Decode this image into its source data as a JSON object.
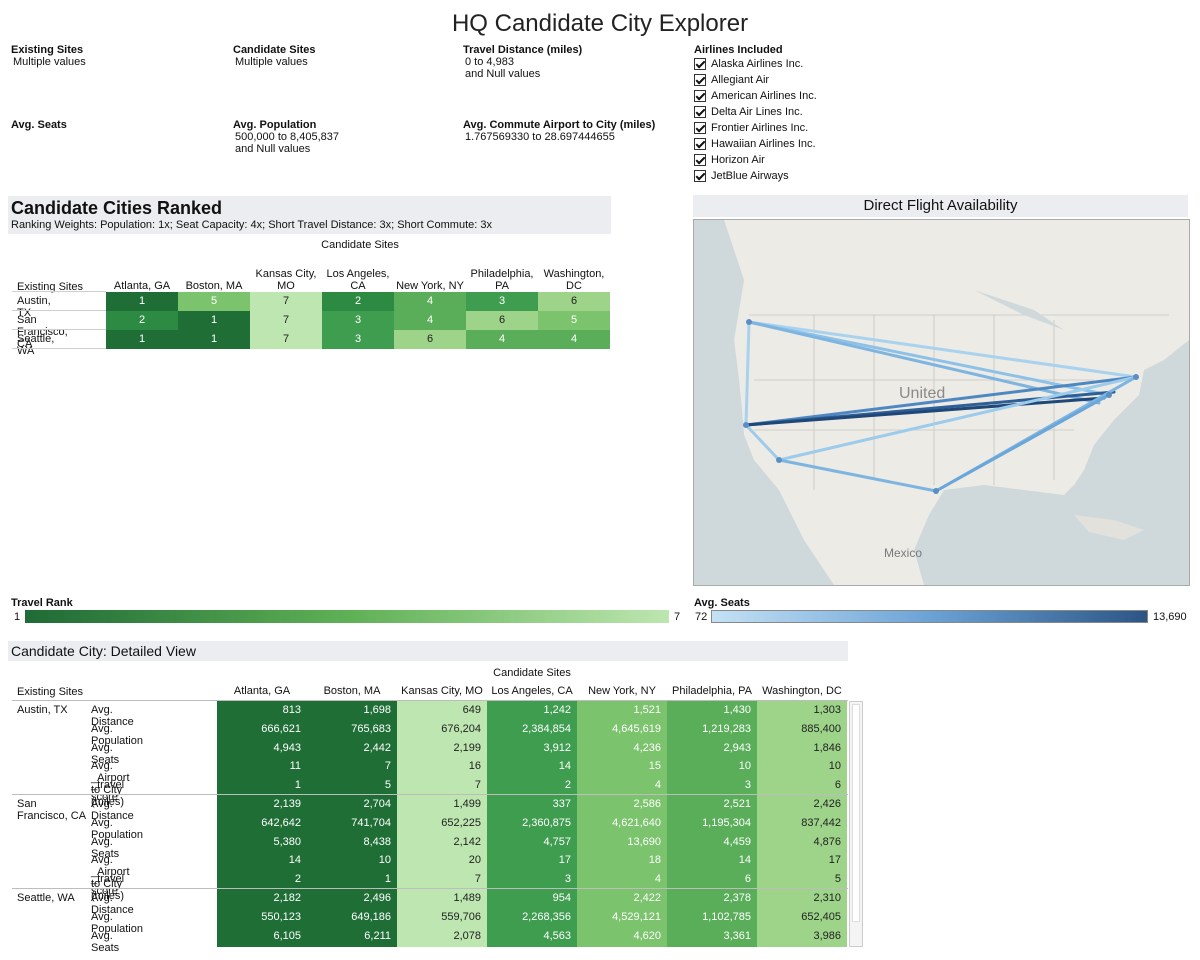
{
  "title": "HQ Candidate City Explorer",
  "filters": {
    "existing_sites": {
      "label": "Existing Sites",
      "value": "Multiple values"
    },
    "candidate_sites": {
      "label": "Candidate Sites",
      "value": "Multiple values"
    },
    "travel_distance": {
      "label": "Travel Distance (miles)",
      "value": "0 to 4,983\nand Null values"
    },
    "avg_seats": {
      "label": "Avg. Seats",
      "value": ""
    },
    "avg_population": {
      "label": "Avg. Population",
      "value": "500,000 to 8,405,837\nand Null values"
    },
    "avg_commute": {
      "label": "Avg. Commute Airport to City (miles)",
      "value": "1.767569330 to 28.697444655"
    }
  },
  "airlines": {
    "label": "Airlines Included",
    "items": [
      "Alaska Airlines Inc.",
      "Allegiant Air",
      "American Airlines Inc.",
      "Delta Air Lines Inc.",
      "Frontier Airlines Inc.",
      "Hawaiian Airlines Inc.",
      "Horizon Air",
      "JetBlue Airways"
    ]
  },
  "ranked": {
    "title": "Candidate Cities Ranked",
    "subtitle": "Ranking Weights: Population: 1x; Seat Capacity: 4x; Short Travel Distance: 3x; Short Commute: 3x",
    "col_group": "Candidate Sites",
    "row_header": "Existing Sites",
    "columns": [
      "Atlanta, GA",
      "Boston, MA",
      "Kansas City, MO",
      "Los Angeles, CA",
      "New York, NY",
      "Philadelphia, PA",
      "Washington, DC"
    ],
    "rows": [
      {
        "site": "Austin, TX",
        "ranks": [
          1,
          5,
          7,
          2,
          4,
          3,
          6
        ]
      },
      {
        "site": "San Francisco, CA",
        "ranks": [
          2,
          1,
          7,
          3,
          4,
          6,
          5
        ]
      },
      {
        "site": "Seattle, WA",
        "ranks": [
          1,
          1,
          7,
          3,
          6,
          4,
          4
        ]
      }
    ]
  },
  "map": {
    "title": "Direct Flight Availability",
    "country_label": "United",
    "mexico_label": "Mexico"
  },
  "legend_travel": {
    "label": "Travel Rank",
    "min": "1",
    "max": "7"
  },
  "legend_seats": {
    "label": "Avg. Seats",
    "min": "72",
    "max": "13,690"
  },
  "detail": {
    "title": "Candidate City: Detailed View",
    "col_group": "Candidate Sites",
    "row_header": "Existing Sites",
    "columns": [
      "Atlanta, GA",
      "Boston, MA",
      "Kansas City, MO",
      "Los Angeles, CA",
      "New York, NY",
      "Philadelphia, PA",
      "Washington, DC"
    ],
    "col_ranks_note": "column shading follows travel rank",
    "groups": [
      {
        "site": "Austin, TX",
        "rows": [
          {
            "measure": "Avg. Distance",
            "values": [
              "813",
              "1,698",
              "649",
              "1,242",
              "1,521",
              "1,430",
              "1,303"
            ]
          },
          {
            "measure": "Avg. Population",
            "values": [
              "666,621",
              "765,683",
              "676,204",
              "2,384,854",
              "4,645,619",
              "1,219,283",
              "885,400"
            ]
          },
          {
            "measure": "Avg. Seats",
            "values": [
              "4,943",
              "2,442",
              "2,199",
              "3,912",
              "4,236",
              "2,943",
              "1,846"
            ]
          },
          {
            "measure": "Avg. _Airport to City (miles)",
            "values": [
              "11",
              "7",
              "16",
              "14",
              "15",
              "10",
              "10"
            ]
          },
          {
            "measure": "_travel score",
            "values": [
              "1",
              "5",
              "7",
              "2",
              "4",
              "3",
              "6"
            ]
          }
        ]
      },
      {
        "site": "San Francisco, CA",
        "rows": [
          {
            "measure": "Avg. Distance",
            "values": [
              "2,139",
              "2,704",
              "1,499",
              "337",
              "2,586",
              "2,521",
              "2,426"
            ]
          },
          {
            "measure": "Avg. Population",
            "values": [
              "642,642",
              "741,704",
              "652,225",
              "2,360,875",
              "4,621,640",
              "1,195,304",
              "837,442"
            ]
          },
          {
            "measure": "Avg. Seats",
            "values": [
              "5,380",
              "8,438",
              "2,142",
              "4,757",
              "13,690",
              "4,459",
              "4,876"
            ]
          },
          {
            "measure": "Avg. _Airport to City (miles)",
            "values": [
              "14",
              "10",
              "20",
              "17",
              "18",
              "14",
              "17"
            ]
          },
          {
            "measure": "_travel score",
            "values": [
              "2",
              "1",
              "7",
              "3",
              "4",
              "6",
              "5"
            ]
          }
        ]
      },
      {
        "site": "Seattle, WA",
        "rows": [
          {
            "measure": "Avg. Distance",
            "values": [
              "2,182",
              "2,496",
              "1,489",
              "954",
              "2,422",
              "2,378",
              "2,310"
            ]
          },
          {
            "measure": "Avg. Population",
            "values": [
              "550,123",
              "649,186",
              "559,706",
              "2,268,356",
              "4,529,121",
              "1,102,785",
              "652,405"
            ]
          },
          {
            "measure": "Avg. Seats",
            "values": [
              "6,105",
              "6,211",
              "2,078",
              "4,563",
              "4,620",
              "3,361",
              "3,986"
            ]
          }
        ]
      }
    ]
  },
  "colors": {
    "rank1": "#1f6e36",
    "rank2": "#2c8a43",
    "rank3": "#3f9d4f",
    "rank4": "#5aae5a",
    "rank5": "#7bc36d",
    "rank6": "#9dd48a",
    "rank7": "#bde6b0",
    "header_bg": "#ebedf1"
  }
}
